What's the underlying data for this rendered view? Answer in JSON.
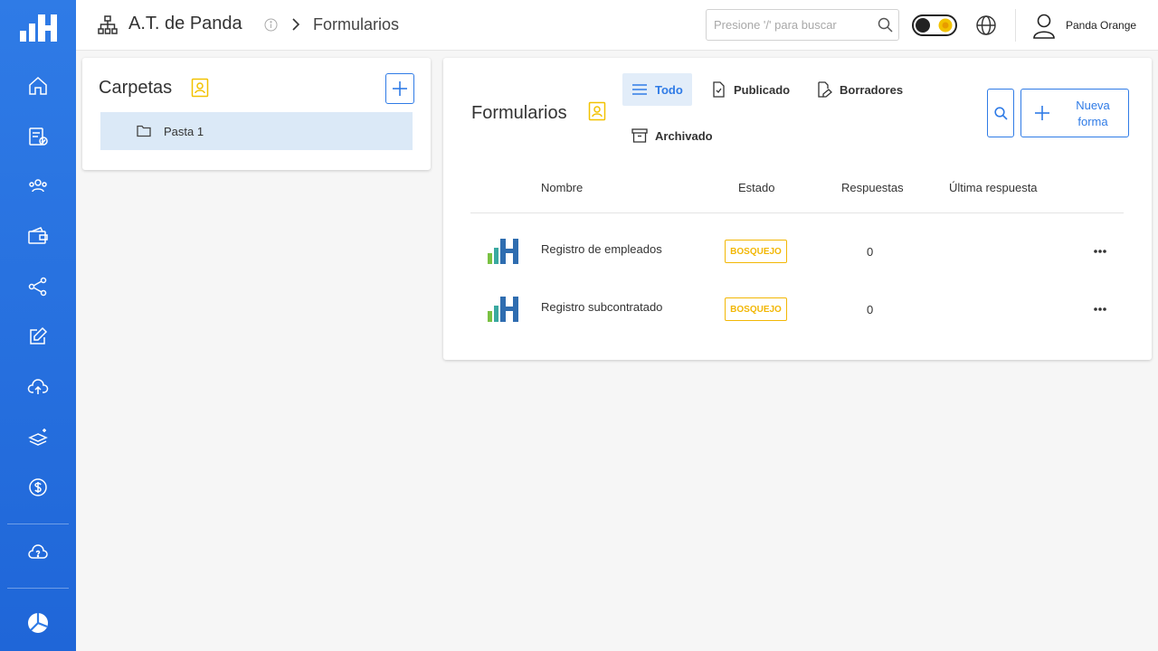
{
  "header": {
    "org_name": "A.T. de Panda",
    "breadcrumb": "Formularios",
    "search_placeholder": "Presione '/' para buscar",
    "user_name": "Panda Orange"
  },
  "sidebar": {
    "items": [
      "home-icon",
      "forms-check-icon",
      "users-icon",
      "wallet-icon",
      "share-icon",
      "edit-icon",
      "cloud-upload-icon",
      "layers-add-icon",
      "dollar-icon",
      "cloud-help-icon",
      "pie-logo-icon"
    ]
  },
  "folders": {
    "title": "Carpetas",
    "items": [
      {
        "label": "Pasta 1"
      }
    ]
  },
  "forms": {
    "title": "Formularios",
    "tabs": {
      "all": "Todo",
      "published": "Publicado",
      "drafts": "Borradores",
      "archived": "Archivado"
    },
    "new_button": "Nueva forma",
    "columns": {
      "name": "Nombre",
      "status": "Estado",
      "responses": "Respuestas",
      "last": "Última respuesta"
    },
    "rows": [
      {
        "name": "Registro de empleados",
        "status": "BOSQUEJO",
        "responses": "0",
        "last": ""
      },
      {
        "name": "Registro subcontratado",
        "status": "BOSQUEJO",
        "responses": "0",
        "last": ""
      }
    ]
  },
  "colors": {
    "accent": "#2f7be6",
    "draft_badge": "#f2b705",
    "contact_icon": "#f2c200"
  }
}
